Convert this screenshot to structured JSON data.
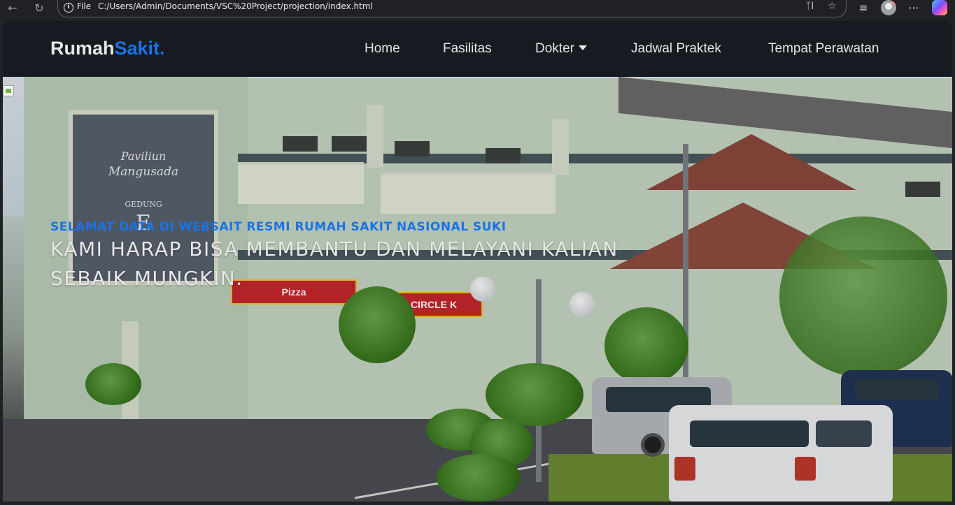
{
  "browser": {
    "file_label": "File",
    "url": "C:/Users/Admin/Documents/VSC%20Project/projection/index.html",
    "icons": [
      "back-icon",
      "reload-icon",
      "info-icon",
      "read-aloud-icon",
      "favorite-star-icon",
      "collections-icon",
      "profile-avatar",
      "more-menu-icon",
      "copilot-icon"
    ]
  },
  "site": {
    "logo_main": "Rumah",
    "logo_accent": "Sakit.",
    "accent_color": "#1a73e8",
    "nav": {
      "home": "Home",
      "fasilitas": "Fasilitas",
      "dokter": "Dokter",
      "jadwal": "Jadwal Praktek",
      "tempat": "Tempat Perawatan"
    }
  },
  "hero": {
    "subtitle": "SELAMAT DATA DI WEBSAIT RESMI RUMAH SAKIT NASIONAL SUKI",
    "title": "KAMI HARAP BISA MEMBANTU DAN MELAYANI KALIAN SEBAIK MUNGKIN.",
    "photo": {
      "sign_line1": "Paviliun",
      "sign_line2": "Mangusada",
      "sign_line3": "GEDUNG",
      "sign_line4": "E",
      "shop_left": "Pizza",
      "shop_right": "CIRCLE K"
    }
  }
}
